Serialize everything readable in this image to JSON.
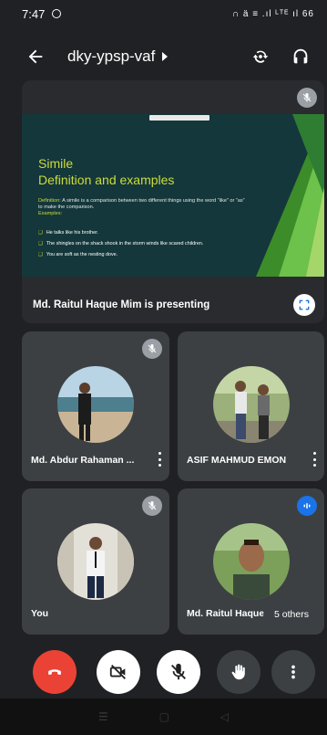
{
  "status_bar": {
    "time": "7:47",
    "right_text": "∩ ä ≡ .ıl ᴸᵀᴱ ıl 66"
  },
  "top_bar": {
    "meeting_code": "dky-ypsp-vaf"
  },
  "presentation": {
    "label": "Md. Raitul Haque Mim is presenting",
    "slide": {
      "title_line1": "Simile",
      "title_line2": "Definition and examples",
      "definition_label": "Definition:",
      "definition_text": " A simile is a comparison between two different things using the word “like” or “as” to make the comparison.",
      "examples_label": "Examples:",
      "examples": [
        "He talks like his brother.",
        "The shingles on the shack shook in the storm winds like scared children.",
        "You are soft as the nesting dove."
      ]
    }
  },
  "participants": [
    {
      "name": "Md. Abdur Rahaman ...",
      "muted": true
    },
    {
      "name": "ASIF MAHMUD EMON",
      "muted": false
    },
    {
      "name": "You",
      "muted": true
    },
    {
      "name": "Md. Raitul Haque",
      "speaking": true
    }
  ],
  "others_chip": "5 others",
  "colors": {
    "end_call": "#ea4335",
    "accent": "#1a73e8",
    "slide_bg": "#14373b",
    "slide_title": "#cddc39"
  }
}
